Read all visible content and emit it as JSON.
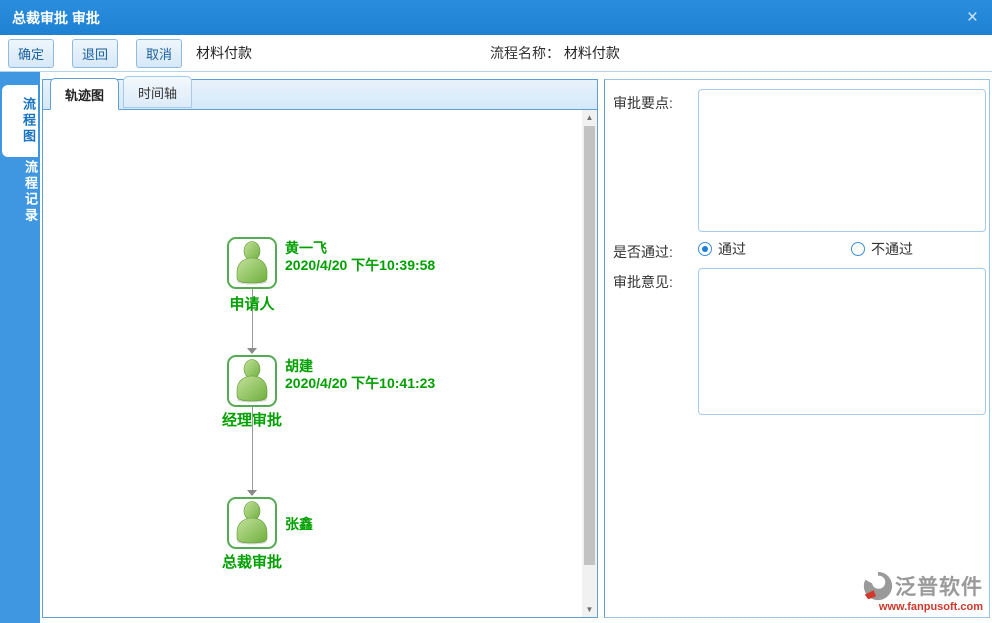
{
  "window": {
    "title": "总裁审批 审批",
    "close_icon": "×"
  },
  "toolbar": {
    "buttons": {
      "ok": "确定",
      "back": "退回",
      "cancel": "取消"
    },
    "doc_title": "材料付款",
    "process_name_label": "流程名称：",
    "process_name_value": "材料付款"
  },
  "side_tabs": {
    "flow_chart": {
      "label": "流程图",
      "active": true
    },
    "flow_record": {
      "label": "流程记录",
      "active": false
    }
  },
  "flow_panel": {
    "tabs": {
      "trajectory": {
        "label": "轨迹图",
        "active": true
      },
      "timeline": {
        "label": "时间轴",
        "active": false
      }
    },
    "nodes": [
      {
        "name": "黄一飞",
        "time": "2020/4/20 下午10:39:58",
        "role": "申请人"
      },
      {
        "name": "胡建",
        "time": "2020/4/20 下午10:41:23",
        "role": "经理审批"
      },
      {
        "name": "张鑫",
        "time": "",
        "role": "总裁审批"
      }
    ],
    "scroll_up_icon": "▲",
    "scroll_down_icon": "▼"
  },
  "form": {
    "approval_points_label": "审批要点:",
    "approval_points_value": "",
    "pass_question_label": "是否通过:",
    "radio_pass": {
      "label": "通过",
      "checked": true
    },
    "radio_fail": {
      "label": "不通过",
      "checked": false
    },
    "opinion_label": "审批意见:",
    "opinion_value": ""
  },
  "watermark": {
    "brand": "泛普软件",
    "url": "www.fanpusoft.com"
  },
  "colors": {
    "titlebar_blue": "#1e81d2",
    "strip_blue": "#3e97e0",
    "panel_border_blue": "#5f9fd6",
    "node_green": "#00a000",
    "icon_border_green": "#54ab54",
    "watermark_red": "#d0392b"
  }
}
